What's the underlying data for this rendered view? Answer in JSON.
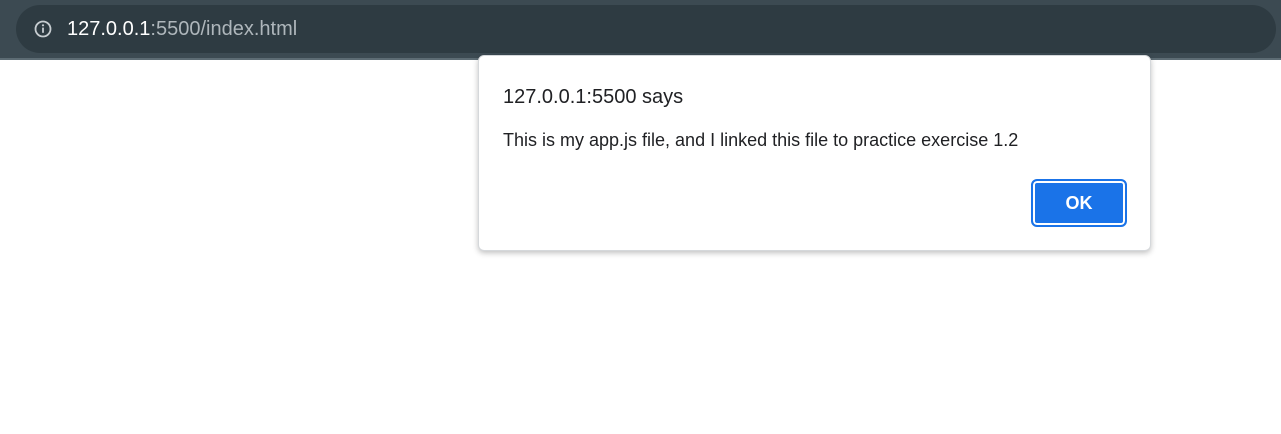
{
  "browser": {
    "url_host": "127.0.0.1",
    "url_rest": ":5500/index.html",
    "info_icon": "info-icon"
  },
  "alert": {
    "title": "127.0.0.1:5500 says",
    "message": "This is my app.js file, and I linked this file to practice exercise 1.2",
    "ok_label": "OK"
  },
  "colors": {
    "toolbar": "#3c4a52",
    "omnibox": "#2e3b42",
    "accent": "#1a73e8"
  }
}
